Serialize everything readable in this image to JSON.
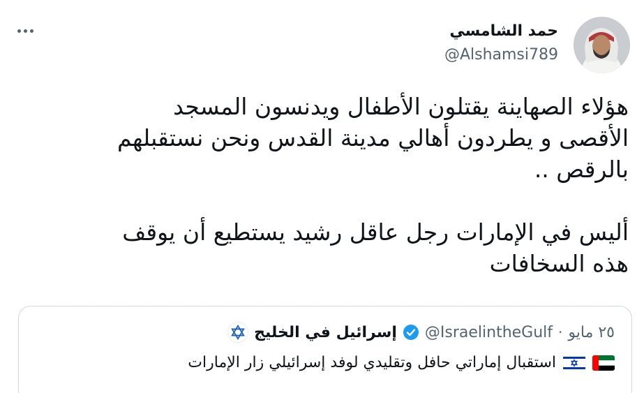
{
  "author": {
    "display_name": "حمد الشامسي",
    "handle": "@Alshamsi789",
    "avatar_icon": "user-avatar"
  },
  "tweet": {
    "lines": [
      "هؤلاء الصهاينة يقتلون  الأطفال ويدنسون المسجد",
      "الأقصى و يطردون أهالي مدينة القدس ونحن نستقبلهم",
      "بالرقص ..",
      "",
      "أليس في الإمارات رجل عاقل رشيد يستطيع أن يوقف",
      "هذه السخافات"
    ]
  },
  "more_icon": "more-horizontal-icon",
  "quoted_tweet": {
    "display_name": "إسرائيل في الخليج",
    "handle": "@IsraelintheGulf",
    "separator": "·",
    "date": "٢٥ مايو",
    "verified_icon": "verified-badge-icon",
    "avatar_icon": "star-of-david-icon",
    "text": "استقبال إماراتي حافل وتقليدي لوفد إسرائيلي زار الإمارات",
    "flags": [
      "israel-flag-icon",
      "uae-flag-icon"
    ]
  },
  "colors": {
    "primary_text": "#0f1419",
    "secondary_text": "#536471",
    "border": "#cfd9de",
    "verified_blue": "#1d9bf0"
  }
}
